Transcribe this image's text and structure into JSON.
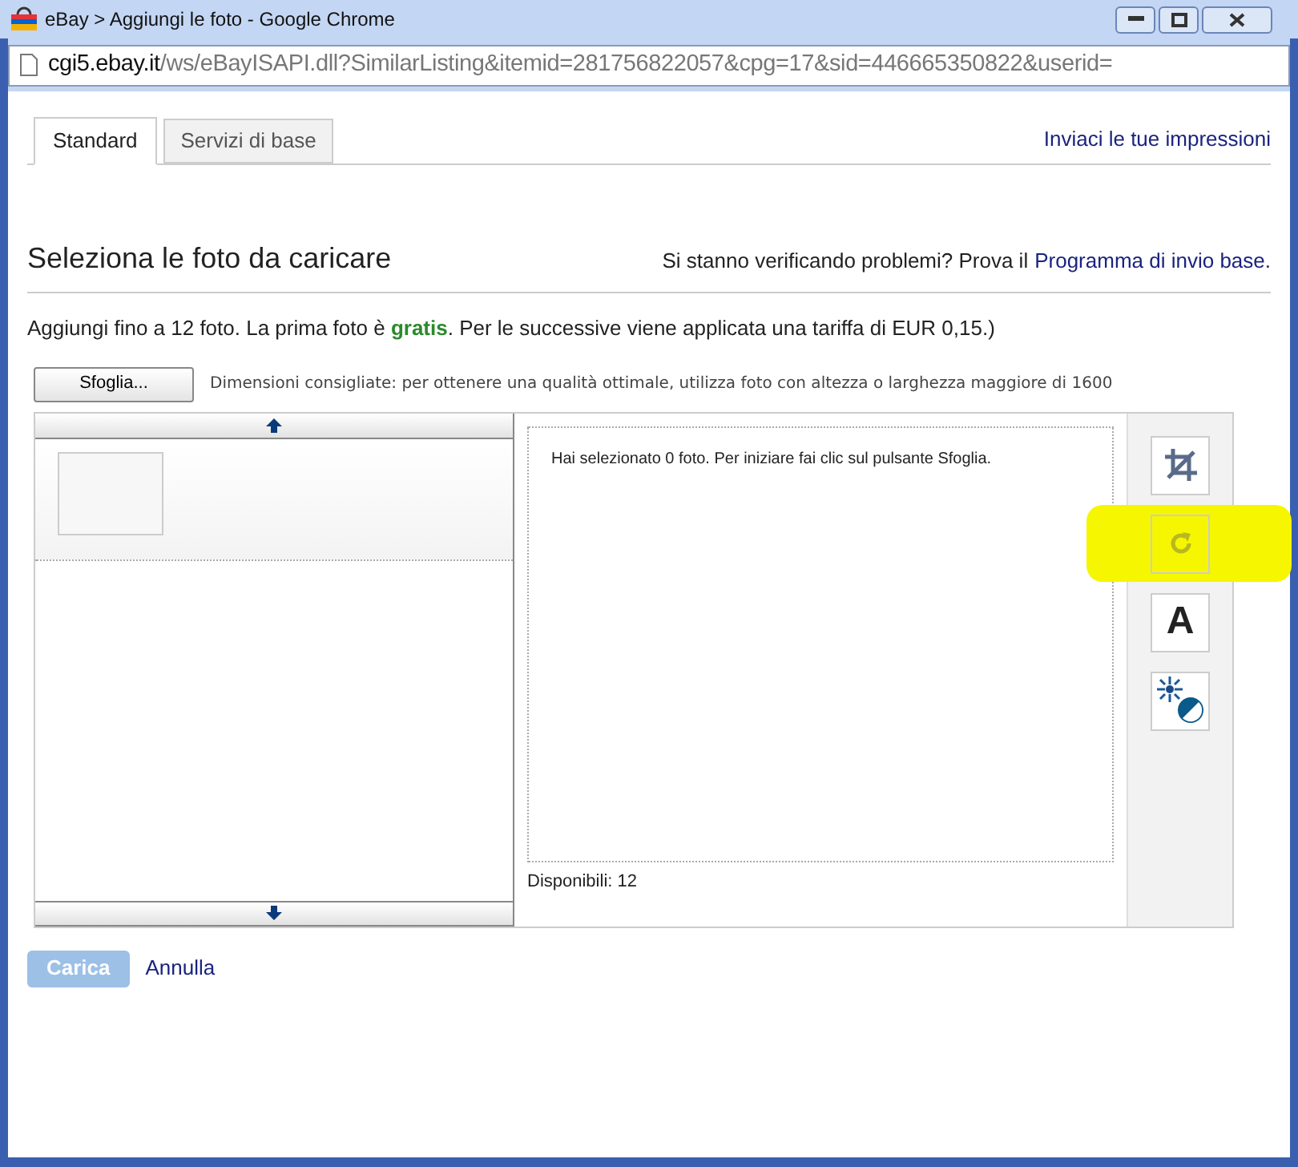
{
  "window": {
    "title": "eBay > Aggiungi le foto - Google Chrome"
  },
  "address_bar": {
    "host": "cgi5.ebay.it",
    "path": "/ws/eBayISAPI.dll?SimilarListing&itemid=281756822057&cpg=17&sid=446665350822&userid="
  },
  "tabs": [
    {
      "label": "Standard",
      "selected": true
    },
    {
      "label": "Servizi di base",
      "selected": false
    }
  ],
  "feedback_link": "Inviaci le tue impressioni",
  "heading": "Seleziona le foto da caricare",
  "help": {
    "text": "Si stanno verificando problemi? Prova il",
    "link": "Programma di invio base."
  },
  "intro": "Aggiungi fino a 12 foto. La prima foto è **gratis**. Per le successive viene applicata una tariffa di EUR 0,15.)",
  "browse_button": "Sfoglia...",
  "dimensions_hint": "Dimensioni consigliate: per ottenere una qualità ottimale, utilizza foto con altezza o larghezza maggiore di 1600",
  "drop_area": {
    "message": "Hai selezionato 0 foto. Per iniziare fai clic sul pulsante Sfoglia.",
    "available": "Disponibili: 12"
  },
  "tools": [
    {
      "kind": "crop",
      "highlighted": false
    },
    {
      "kind": "rotate",
      "highlighted": true
    },
    {
      "kind": "text",
      "label": "A",
      "highlighted": false
    },
    {
      "kind": "brightness",
      "highlighted": false
    }
  ],
  "actions": {
    "upload": {
      "label": "Carica",
      "disabled": true
    },
    "cancel": "Annulla"
  }
}
